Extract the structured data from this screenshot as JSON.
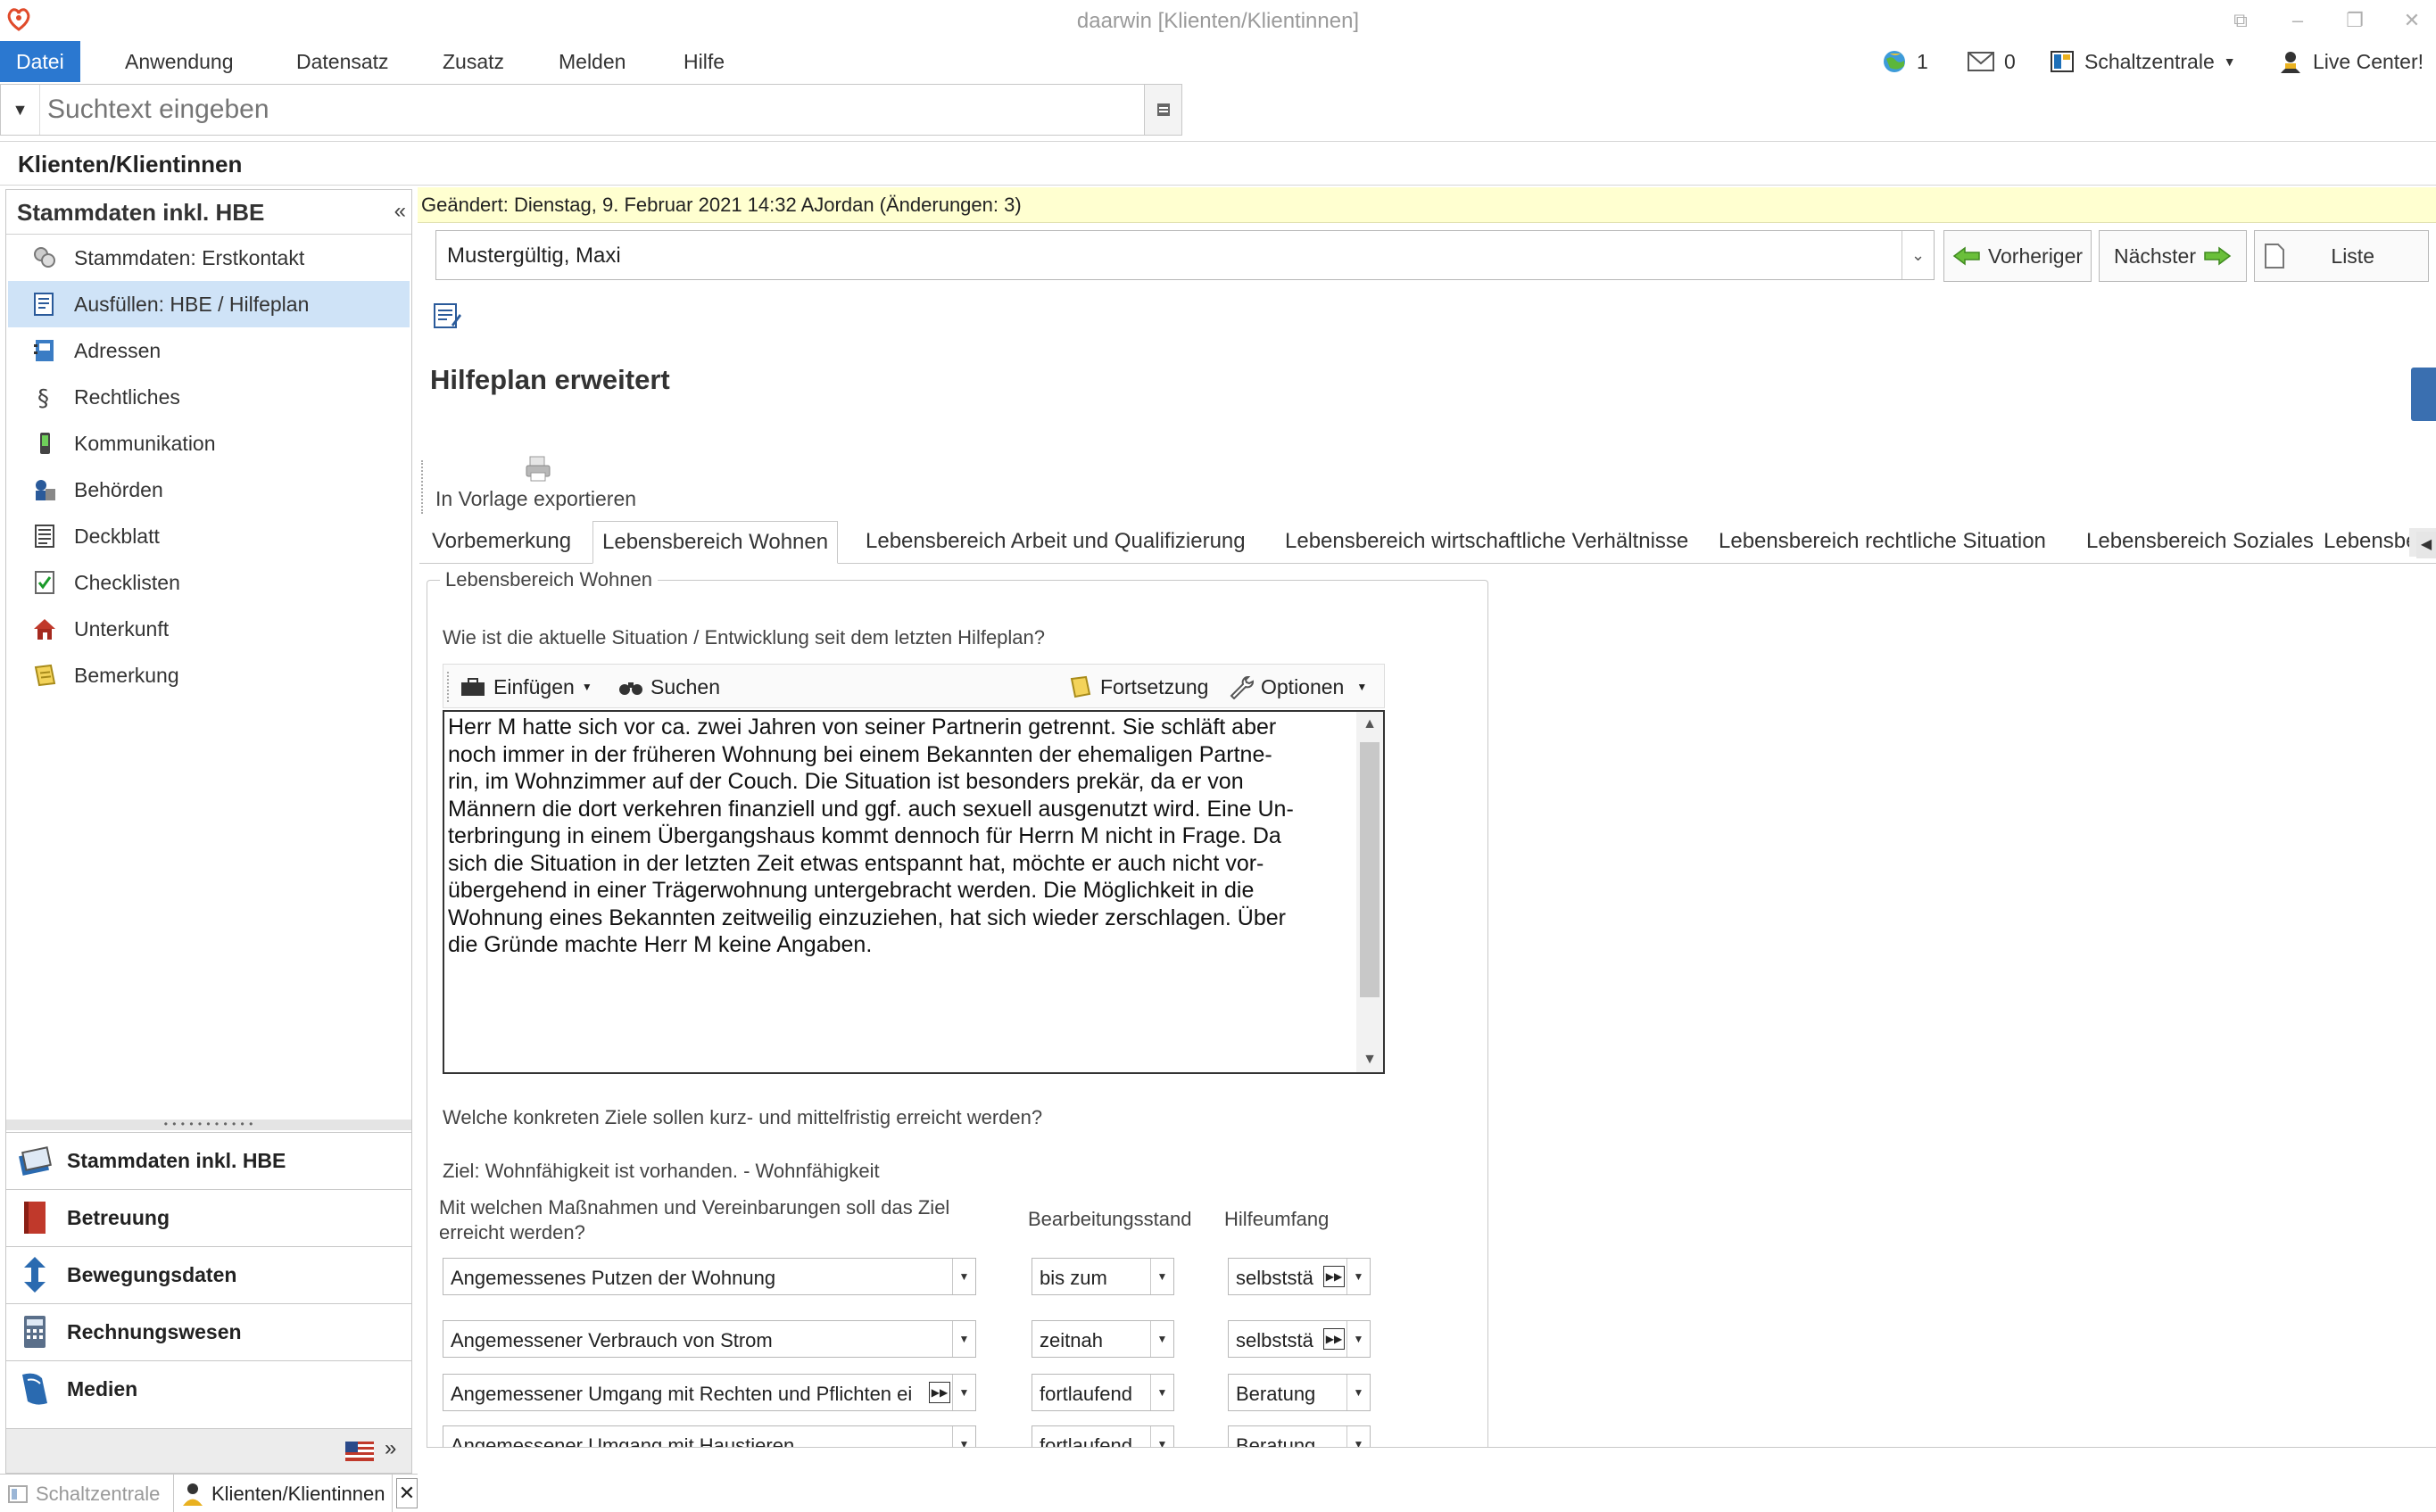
{
  "window": {
    "title": "daarwin [Klienten/Klientinnen]"
  },
  "menu": {
    "items": [
      "Datei",
      "Anwendung",
      "Datensatz",
      "Zusatz",
      "Melden",
      "Hilfe"
    ],
    "active": "Datei",
    "right": {
      "globe_count": "1",
      "mail_count": "0",
      "schaltzentrale": "Schaltzentrale",
      "live_center": "Live Center!"
    }
  },
  "search": {
    "placeholder": "Suchtext eingeben"
  },
  "section_title": "Klienten/Klientinnen",
  "sidebar": {
    "title": "Stammdaten inkl. HBE",
    "collapse": "«",
    "items": [
      {
        "label": "Stammdaten: Erstkontakt",
        "icon": "contacts-icon"
      },
      {
        "label": "Ausfüllen: HBE / Hilfeplan",
        "icon": "form-edit-icon",
        "selected": true
      },
      {
        "label": "Adressen",
        "icon": "address-book-icon"
      },
      {
        "label": "Rechtliches",
        "icon": "paragraph-icon"
      },
      {
        "label": "Kommunikation",
        "icon": "phone-icon"
      },
      {
        "label": "Behörden",
        "icon": "authority-icon"
      },
      {
        "label": "Deckblatt",
        "icon": "cover-sheet-icon"
      },
      {
        "label": "Checklisten",
        "icon": "checklist-icon"
      },
      {
        "label": "Unterkunft",
        "icon": "house-icon"
      },
      {
        "label": "Bemerkung",
        "icon": "note-icon"
      }
    ],
    "modules": [
      {
        "label": "Stammdaten inkl. HBE",
        "icon": "master-data-icon"
      },
      {
        "label": "Betreuung",
        "icon": "care-book-icon"
      },
      {
        "label": "Bewegungsdaten",
        "icon": "updown-arrows-icon"
      },
      {
        "label": "Rechnungswesen",
        "icon": "calculator-icon"
      },
      {
        "label": "Medien",
        "icon": "media-icon"
      }
    ],
    "footer_more": "»"
  },
  "record": {
    "changed": "Geändert: Dienstag, 9. Februar 2021 14:32  AJordan  (Änderungen: 3)",
    "client": "Mustergültig, Maxi",
    "prev": "Vorheriger",
    "next": "Nächster",
    "list": "Liste"
  },
  "form": {
    "title": "Hilfeplan erweitert",
    "export": "In Vorlage exportieren"
  },
  "tabs": [
    "Vorbemerkung",
    "Lebensbereich Wohnen",
    "Lebensbereich Arbeit und Qualifizierung",
    "Lebensbereich wirtschaftliche Verhältnisse",
    "Lebensbereich rechtliche Situation",
    "Lebensbereich Soziales",
    "Lebensbe"
  ],
  "active_tab": "Lebensbereich Wohnen",
  "group": {
    "legend": "Lebensbereich Wohnen",
    "question1": "Wie ist die aktuelle Situation / Entwicklung seit dem letzten Hilfeplan?",
    "toolbar": {
      "insert": "Einfügen",
      "search": "Suchen",
      "continue": "Fortsetzung",
      "options": "Optionen"
    },
    "text_lines": [
      "Herr M hatte sich vor ca. zwei Jahren von seiner Partnerin getrennt. Sie schläft aber",
      "noch immer in der früheren Wohnung  bei einem Bekannten der ehemaligen Partne-",
      "rin, im Wohnzimmer auf der Couch. Die Situation ist besonders prekär, da er von",
      "Männern die dort verkehren finanziell und ggf. auch sexuell ausgenutzt wird. Eine Un-",
      "terbringung in einem Übergangshaus kommt dennoch für Herrn M nicht in Frage. Da",
      "sich die Situation in der letzten Zeit etwas entspannt hat, möchte er auch nicht vor-",
      "übergehend in einer Trägerwohnung untergebracht werden. Die Möglichkeit in die",
      "Wohnung eines Bekannten zeitweilig einzuziehen, hat sich wieder zerschlagen. Über",
      "die Gründe machte Herr M keine Angaben."
    ],
    "question2": "Welche konkreten Ziele sollen kurz- und mittelfristig erreicht werden?",
    "goal": "Ziel: Wohnfähigkeit ist vorhanden. - Wohnfähigkeit",
    "measures_header_line1": "Mit welchen Maßnahmen und Vereinbarungen soll das Ziel",
    "measures_header_line2": "erreicht werden?",
    "status_header": "Bearbeitungsstand",
    "scope_header": "Hilfeumfang",
    "rows": [
      {
        "measure": "Angemessenes Putzen der Wohnung",
        "status": "bis zum",
        "scope": "selbststä",
        "scope_more": true,
        "measure_more": false
      },
      {
        "measure": "Angemessener Verbrauch von Strom",
        "status": "zeitnah",
        "scope": "selbststä",
        "scope_more": true,
        "measure_more": false
      },
      {
        "measure": "Angemessener Umgang mit Rechten und Pflichten ei",
        "status": "fortlaufend",
        "scope": "Beratung",
        "scope_more": false,
        "measure_more": true
      },
      {
        "measure": "Angemessener Umgang mit Haustieren",
        "status": "fortlaufend",
        "scope": "Beratung",
        "scope_more": false,
        "measure_more": false
      }
    ]
  },
  "bottom_tabs": {
    "tab1": "Schaltzentrale",
    "tab2": "Klienten/Klientinnen"
  },
  "colors": {
    "accent": "#2b78d0",
    "selected_row": "#cfe3f7",
    "changed_bar": "#ffffd0"
  }
}
